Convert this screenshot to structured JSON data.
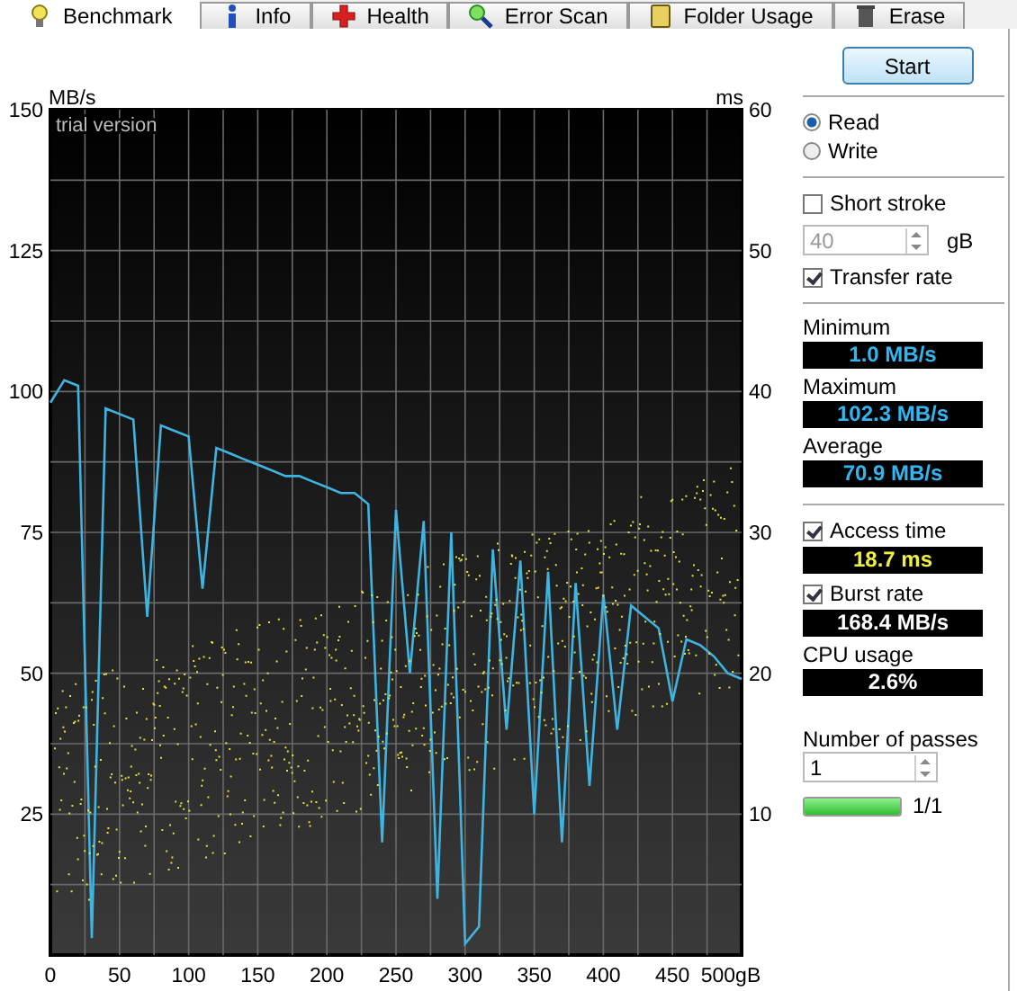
{
  "tabs": [
    {
      "label": "Benchmark",
      "selected": true
    },
    {
      "label": "Info",
      "selected": false
    },
    {
      "label": "Health",
      "selected": false
    },
    {
      "label": "Error Scan",
      "selected": false
    },
    {
      "label": "Folder Usage",
      "selected": false
    },
    {
      "label": "Erase",
      "selected": false
    }
  ],
  "chart": {
    "watermark": "trial version",
    "chart_data": {
      "type": "line",
      "grid": true,
      "ylabel": "MB/s",
      "x": [
        0,
        10,
        20,
        30,
        40,
        50,
        60,
        70,
        80,
        90,
        100,
        110,
        120,
        130,
        140,
        150,
        160,
        170,
        180,
        190,
        200,
        210,
        220,
        230,
        240,
        250,
        260,
        270,
        280,
        290,
        300,
        310,
        320,
        330,
        340,
        350,
        360,
        370,
        380,
        390,
        400,
        410,
        420,
        430,
        440,
        450,
        460,
        470,
        480,
        490,
        500
      ],
      "xlim": [
        0,
        500
      ],
      "ylim": [
        0,
        150
      ],
      "xticks": [
        0,
        50,
        100,
        150,
        200,
        250,
        300,
        350,
        400,
        450,
        {
          "value": 500,
          "label": "500gB"
        }
      ],
      "yticks": [
        25,
        50,
        75,
        100,
        125,
        150
      ],
      "series": [
        {
          "color": "#3fb4e0",
          "values": [
            98,
            102,
            101,
            3,
            97,
            96,
            95,
            60,
            94,
            93,
            92,
            65,
            90,
            89,
            88,
            87,
            86,
            85,
            85,
            84,
            83,
            82,
            82,
            80,
            20,
            79,
            50,
            77,
            10,
            75,
            2,
            5,
            72,
            40,
            70,
            25,
            68,
            20,
            66,
            30,
            64,
            40,
            62,
            60,
            58,
            45,
            56,
            55,
            53,
            50,
            49
          ]
        }
      ]
    }
  },
  "ms_axis": {
    "label": "ms",
    "ticks": [
      "60",
      "50",
      "40",
      "30",
      "20",
      "10"
    ]
  },
  "start_button": "Start",
  "modes": [
    {
      "label": "Read",
      "selected": true
    },
    {
      "label": "Write",
      "selected": false
    }
  ],
  "short_stroke": {
    "label": "Short stroke",
    "checked": false,
    "value": "40",
    "unit": "gB"
  },
  "transfer_rate": {
    "label": "Transfer rate",
    "checked": true,
    "stats": [
      {
        "label": "Minimum",
        "reading": "1.0 MB/s"
      },
      {
        "label": "Maximum",
        "reading": "102.3 MB/s"
      },
      {
        "label": "Average",
        "reading": "70.9 MB/s"
      }
    ]
  },
  "access_time": {
    "label": "Access time",
    "checked": true,
    "reading": "18.7 ms"
  },
  "burst_rate": {
    "label": "Burst rate",
    "checked": true,
    "reading": "168.4 MB/s"
  },
  "cpu_usage": {
    "label": "CPU usage",
    "reading": "2.6%"
  },
  "passes": {
    "label": "Number of passes",
    "value": "1"
  },
  "progress": {
    "level": 1,
    "text": "1/1"
  }
}
